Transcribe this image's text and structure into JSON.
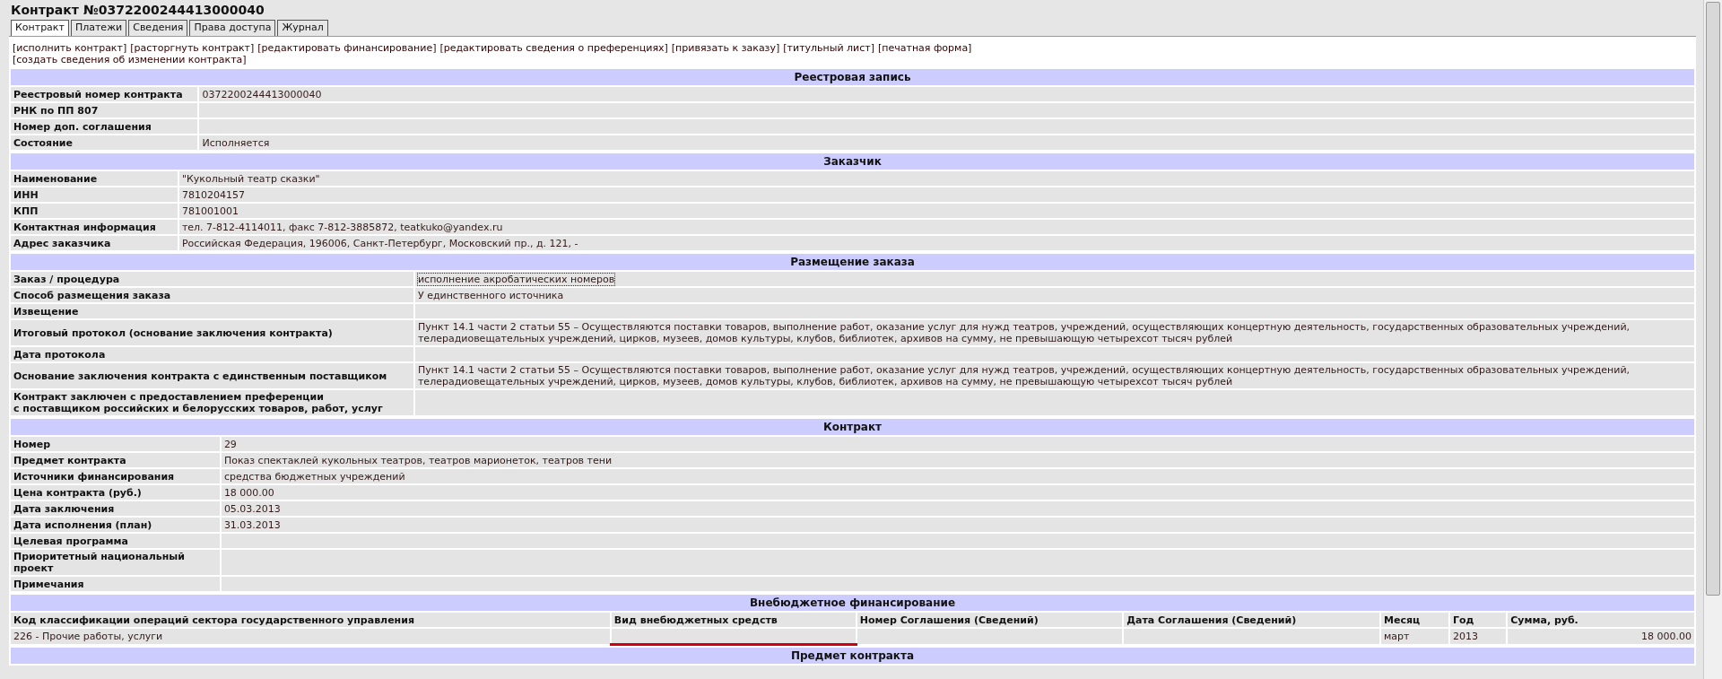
{
  "title": "Контракт №0372200244413000040",
  "tabs": [
    {
      "label": "Контракт",
      "selected": true
    },
    {
      "label": "Платежи",
      "selected": false
    },
    {
      "label": "Сведения",
      "selected": false
    },
    {
      "label": "Права доступа",
      "selected": false
    },
    {
      "label": "Журнал",
      "selected": false
    }
  ],
  "actions": [
    "[исполнить контракт]",
    "[расторгнуть контракт]",
    "[редактировать финансирование]",
    "[редактировать сведения о преференциях]",
    "[привязать к заказу]",
    "[титульный лист]",
    "[печатная форма]",
    "[создать сведения об изменении контракта]"
  ],
  "sections": [
    {
      "kind": "fields",
      "title": "Реестровая запись",
      "rows": [
        {
          "label": "Реестровый номер контракта",
          "value": "0372200244413000040"
        },
        {
          "label": "РНК по ПП 807"
        },
        {
          "label": "Номер доп. соглашения"
        },
        {
          "label": "Состояние",
          "value": "Исполняется"
        }
      ]
    },
    {
      "kind": "fields",
      "title": "Заказчик",
      "rows": [
        {
          "label": "Наименование",
          "value": "\"Кукольный театр сказки\""
        },
        {
          "label": "ИНН",
          "value": "7810204157"
        },
        {
          "label": "КПП",
          "value": "781001001"
        },
        {
          "label": "Контактная информация",
          "value": "тел. 7-812-4114011, факс 7-812-3885872, teatkuko@yandex.ru"
        },
        {
          "label": "Адрес заказчика",
          "value": "Российская Федерация, 196006, Санкт-Петербург, Московский пр., д. 121, -"
        }
      ]
    },
    {
      "kind": "fields",
      "title": "Размещение заказа",
      "rows": [
        {
          "label": "Заказ / процедура",
          "value": "исполнение акробатических номеров",
          "focused": true
        },
        {
          "label": "Способ размещения заказа",
          "value": "У единственного источника"
        },
        {
          "label": "Извещение"
        },
        {
          "label": "Итоговый протокол (основание заключения контракта)",
          "value": "Пункт 14.1 части 2 статьи 55 – Осуществляются поставки товаров, выполнение работ, оказание услуг для нужд театров, учреждений, осуществляющих концертную деятельность, государственных образовательных учреждений, телерадиовещательных учреждений, цирков, музеев, домов культуры, клубов, библиотек, архивов на сумму, не превышающую четырехсот тысяч рублей"
        },
        {
          "label": "Дата протокола"
        },
        {
          "label": "Основание заключения контракта с единственным поставщиком",
          "value": "Пункт 14.1 части 2 статьи 55 – Осуществляются поставки товаров, выполнение работ, оказание услуг для нужд театров, учреждений, осуществляющих концертную деятельность, государственных образовательных учреждений, телерадиовещательных учреждений, цирков, музеев, домов культуры, клубов, библиотек, архивов на сумму, не превышающую четырехсот тысяч рублей"
        },
        {
          "label": "Контракт заключен с предоставлением преференции\nс поставщиком российских и белорусских товаров, работ, услуг"
        }
      ]
    },
    {
      "kind": "fields",
      "title": "Контракт",
      "rows": [
        {
          "label": "Номер",
          "value": "29"
        },
        {
          "label": "Предмет контракта",
          "value": "Показ спектаклей кукольных театров, театров марионеток, театров тени"
        },
        {
          "label": "Источники финансирования",
          "value": "средства бюджетных учреждений"
        },
        {
          "label": "Цена контракта (руб.)",
          "value": "18 000.00"
        },
        {
          "label": "Дата заключения",
          "value": "05.03.2013"
        },
        {
          "label": "Дата исполнения (план)",
          "value": "31.03.2013"
        },
        {
          "label": "Целевая программа"
        },
        {
          "label": "Приоритетный национальный проект"
        },
        {
          "label": "Примечания"
        }
      ]
    },
    {
      "kind": "table",
      "title": "Внебюджетное финансирование",
      "columns": [
        {
          "label": "Код классификации операций сектора государственного управления",
          "marked": false
        },
        {
          "label": "Вид внебюджетных средств",
          "marked": true
        },
        {
          "label": "Номер Соглашения (Сведений)",
          "marked": false
        },
        {
          "label": "Дата Соглашения (Сведений)",
          "marked": false
        },
        {
          "label": "Месяц",
          "marked": false
        },
        {
          "label": "Год",
          "marked": false
        },
        {
          "label": "Сумма, руб.",
          "marked": false
        }
      ],
      "rows": [
        [
          "226 - Прочие работы, услуги",
          "",
          "",
          "",
          "март",
          "2013",
          "18 000.00"
        ]
      ]
    },
    {
      "kind": "fields",
      "title": "Предмет контракта"
    }
  ]
}
